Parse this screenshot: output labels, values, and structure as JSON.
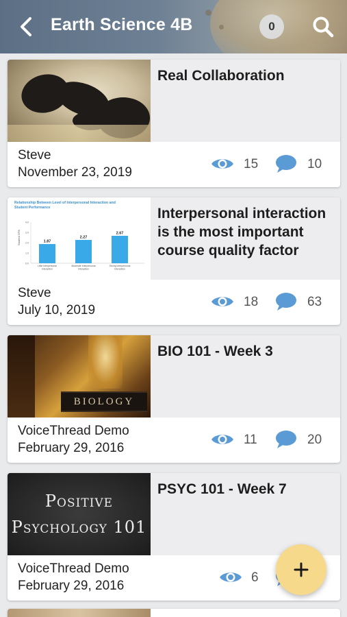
{
  "header": {
    "title": "Earth Science 4B",
    "notification_count": "0",
    "back_icon": "chevron-left-icon",
    "search_icon": "search-icon"
  },
  "colors": {
    "accent_blue": "#5b9bd5",
    "fab_yellow": "#f6d98a",
    "card_title_bg": "#ededef"
  },
  "cards": [
    {
      "title": "Real Collaboration",
      "author": "Steve",
      "date": "November 23, 2019",
      "views": "15",
      "comments": "10",
      "thumbnail": "chimpanzees-photo"
    },
    {
      "title": "Interpersonal interaction is the most important course quality factor",
      "author": "Steve",
      "date": "July 10, 2019",
      "views": "18",
      "comments": "63",
      "thumbnail": "bar-chart-image",
      "thumb_chart": {
        "title": "Relationship Between Level of Interpersonal Interaction and Student Performance",
        "ylabel": "Student GPA",
        "ticks": [
          "4.0",
          "3.0",
          "2.0",
          "1.0",
          "0.0"
        ],
        "bars": [
          {
            "label": "Little Interpersonal Interaction",
            "value": "1.87",
            "num": 1.87
          },
          {
            "label": "Moderate Interpersonal Interaction",
            "value": "2.27",
            "num": 2.27
          },
          {
            "label": "Strong Interpersonal Interaction",
            "value": "2.67",
            "num": 2.67
          }
        ]
      }
    },
    {
      "title": "BIO 101 - Week 3",
      "author": "VoiceThread Demo",
      "date": "February 29, 2016",
      "views": "11",
      "comments": "20",
      "thumbnail": "biology-book-photo",
      "thumb_text": "BIOLOGY"
    },
    {
      "title": "PSYC 101 - Week 7",
      "author": "VoiceThread Demo",
      "date": "February 29, 2016",
      "views": "6",
      "comments": "",
      "thumbnail": "chalkboard-image",
      "thumb_lines": [
        "Positive",
        "Psychology 101"
      ]
    }
  ],
  "fab": {
    "label": "+",
    "icon": "plus-icon"
  }
}
